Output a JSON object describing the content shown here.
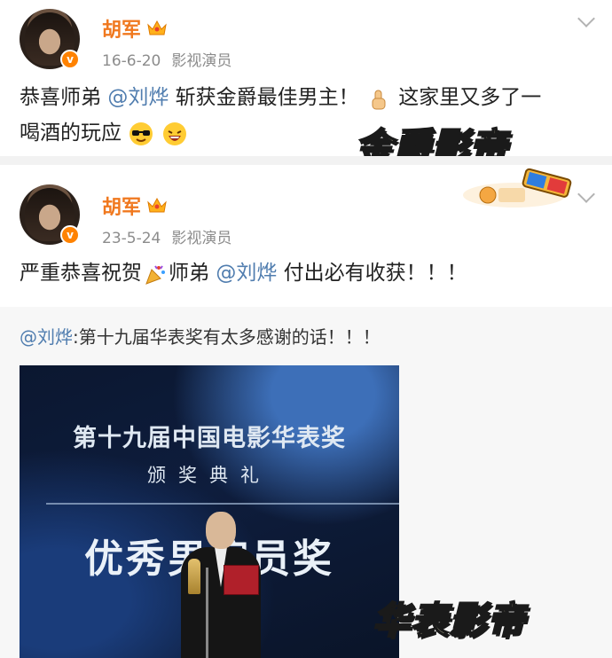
{
  "posts": [
    {
      "author": "胡军",
      "date": "16-6-20",
      "source": "影视演员",
      "text_prefix": "恭喜师弟 ",
      "mention": "@刘烨",
      "text_suffix": " 斩获金爵最佳男主！",
      "text_line2_a": " 这家里又多了一",
      "text_line2_b": "喝酒的玩应",
      "verified_badge": "v",
      "stamp": "金爵影帝"
    },
    {
      "author": "胡军",
      "date": "23-5-24",
      "source": "影视演员",
      "text_prefix": "严重恭喜祝贺",
      "text_mid": "师弟 ",
      "mention": "@刘烨",
      "text_suffix": " 付出必有收获！！！",
      "verified_badge": "v"
    }
  ],
  "repost": {
    "mention": "@刘烨",
    "text": ":第十九届华表奖有太多感谢的话！！！",
    "photo": {
      "line1": "第十九届中国电影华表奖",
      "line2": "颁奖典礼",
      "line3": "优秀男演员奖"
    },
    "stamp": "华表影帝"
  },
  "colors": {
    "author": "#f0781e",
    "mention": "#507daf",
    "meta": "#8c8c8c",
    "verified": "#ff8200",
    "separator": "#f2f2f2",
    "repost_bg": "#f7f7f7"
  },
  "icons": [
    "crown-icon",
    "verified-icon",
    "chevron-down-icon",
    "thumbs-up-icon",
    "cool-emoji-icon",
    "laugh-emoji-icon",
    "party-popper-icon",
    "3d-glasses-icon"
  ]
}
